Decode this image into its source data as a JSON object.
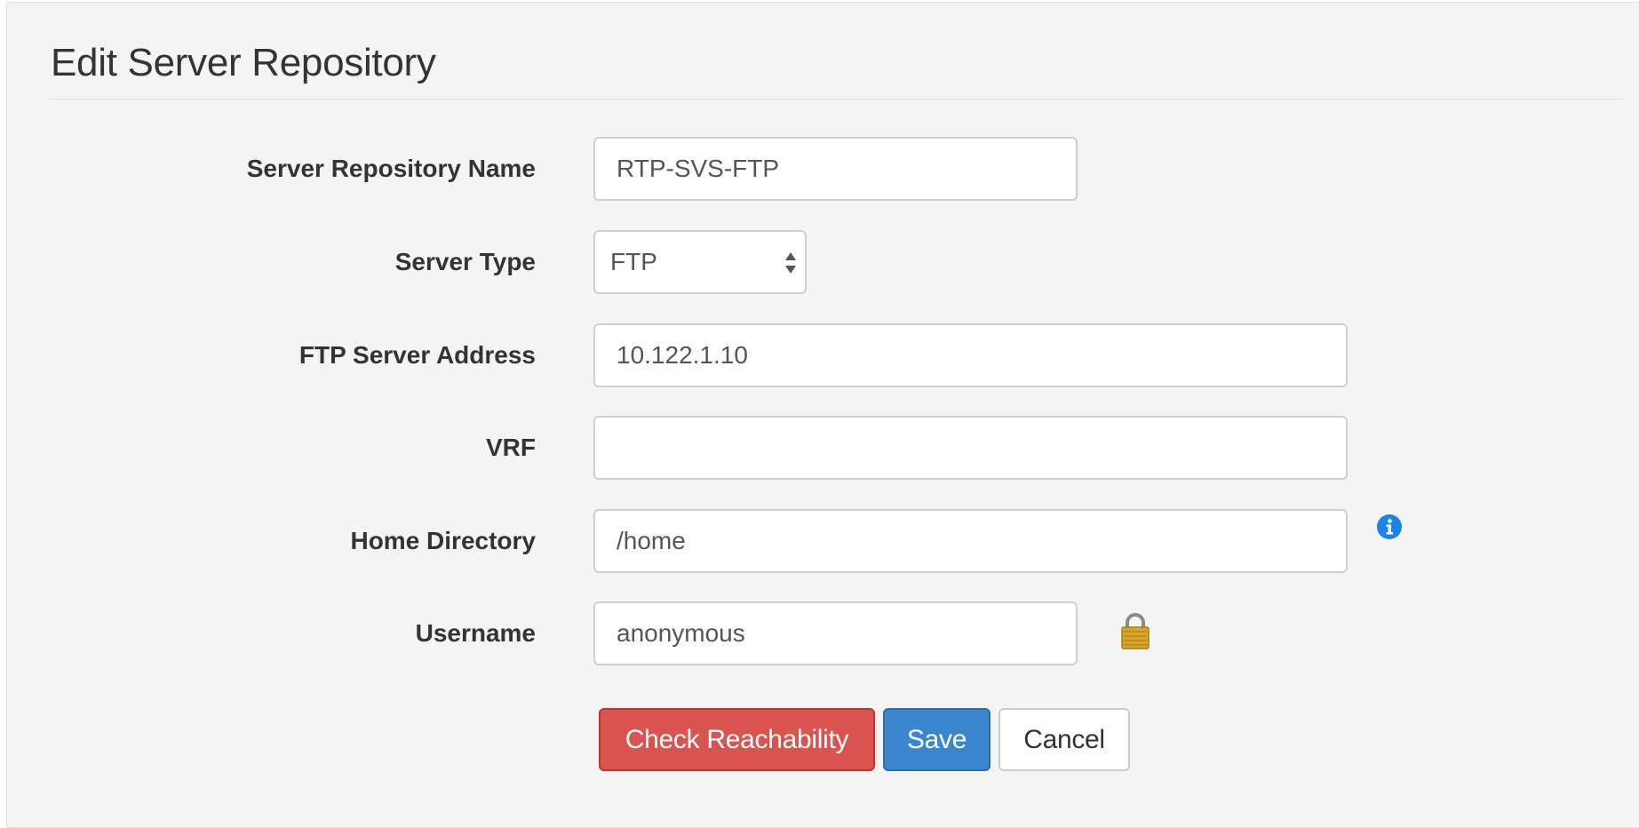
{
  "page": {
    "title": "Edit Server Repository"
  },
  "form": {
    "repository_name": {
      "label": "Server Repository Name",
      "value": "RTP-SVS-FTP"
    },
    "server_type": {
      "label": "Server Type",
      "value": "FTP"
    },
    "ftp_server_address": {
      "label": "FTP Server Address",
      "value": "10.122.1.10"
    },
    "vrf": {
      "label": "VRF",
      "value": ""
    },
    "home_directory": {
      "label": "Home Directory",
      "value": "/home",
      "help_icon": "info-icon"
    },
    "username": {
      "label": "Username",
      "value": "anonymous",
      "lock_icon": "lock-icon"
    }
  },
  "actions": {
    "check_reachability_label": "Check Reachability",
    "save_label": "Save",
    "cancel_label": "Cancel"
  },
  "colors": {
    "danger": "#d9534f",
    "primary": "#3a87cf",
    "info_icon": "#1a82e8",
    "lock_icon": "#d4a62a",
    "panel_background": "#f4f4f4"
  }
}
